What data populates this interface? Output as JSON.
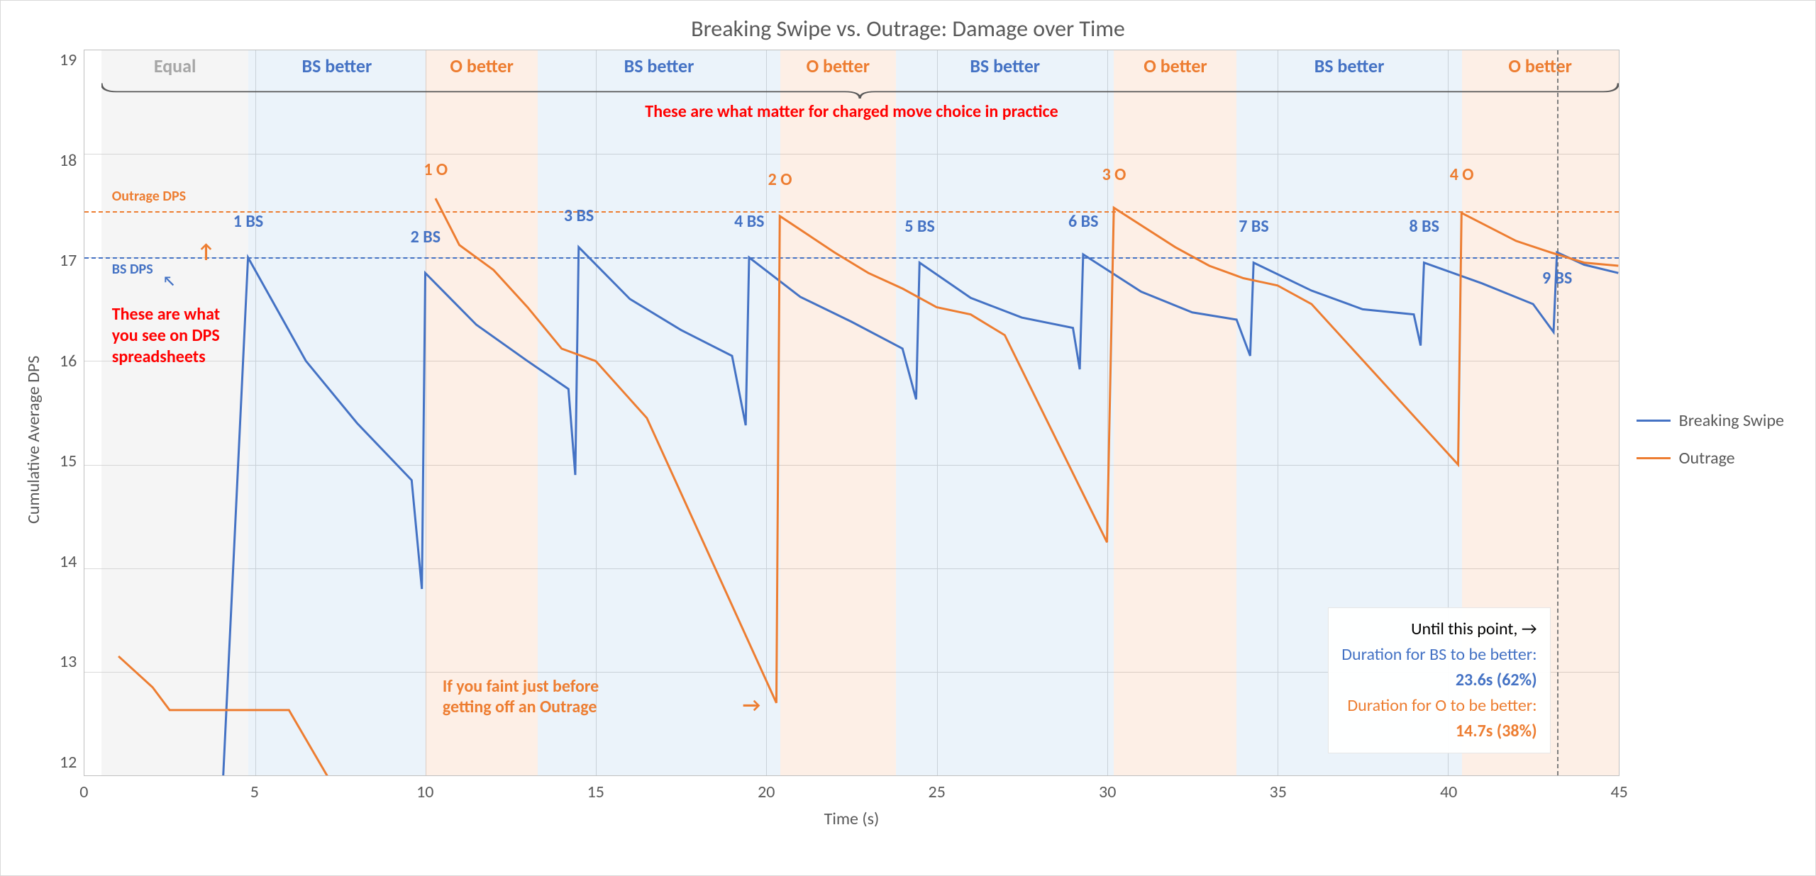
{
  "title": "Breaking Swipe vs. Outrage: Damage over Time",
  "ylabel": "Cumulative Average DPS",
  "xlabel": "Time (s)",
  "legend": {
    "series1": "Breaking Swipe",
    "series2": "Outrage"
  },
  "colors": {
    "blue": "#4472c4",
    "orange": "#ed7d31",
    "red": "#ff0000",
    "gray": "#a6a6a6"
  },
  "refs": {
    "bs_dps_label": "BS DPS",
    "outrage_dps_label": "Outrage DPS"
  },
  "bands": {
    "equal": "Equal",
    "bs": "BS better",
    "o": "O better"
  },
  "peaks": {
    "bs1": "1 BS",
    "bs2": "2 BS",
    "bs3": "3 BS",
    "bs4": "4 BS",
    "bs5": "5 BS",
    "bs6": "6 BS",
    "bs7": "7 BS",
    "bs8": "8 BS",
    "bs9": "9 BS",
    "o1": "1 O",
    "o2": "2 O",
    "o3": "3 O",
    "o4": "4 O"
  },
  "annotations": {
    "top_red": "These are what matter for charged move choice in practice",
    "left_red": "These are what\nyou see on DPS\nspreadsheets",
    "faint": "If you faint just before\ngetting off an Outrage"
  },
  "callout": {
    "line1": "Until this point,  →",
    "line2": "Duration for BS to be better:",
    "line2_val": "23.6s (62%)",
    "line3": "Duration for O to be better:",
    "line3_val": "14.7s (38%)"
  },
  "chart_data": {
    "type": "line",
    "title": "Breaking Swipe vs. Outrage: Damage over Time",
    "xlabel": "Time (s)",
    "ylabel": "Cumulative Average DPS",
    "xlim": [
      0,
      45
    ],
    "ylim": [
      12,
      19
    ],
    "x_ticks": [
      0,
      5,
      10,
      15,
      20,
      25,
      30,
      35,
      40,
      45
    ],
    "y_ticks": [
      12,
      13,
      14,
      15,
      16,
      17,
      18,
      19
    ],
    "reference_lines": {
      "bs_dps": 17.0,
      "outrage_dps": 17.45
    },
    "bands": [
      {
        "label": "Equal",
        "start": 0.5,
        "end": 4.8,
        "type": "gray"
      },
      {
        "label": "BS better",
        "start": 4.8,
        "end": 10.0,
        "type": "blue"
      },
      {
        "label": "O better",
        "start": 10.0,
        "end": 13.3,
        "type": "orange"
      },
      {
        "label": "BS better",
        "start": 13.3,
        "end": 20.4,
        "type": "blue"
      },
      {
        "label": "O better",
        "start": 20.4,
        "end": 23.8,
        "type": "orange"
      },
      {
        "label": "BS better",
        "start": 23.8,
        "end": 30.2,
        "type": "blue"
      },
      {
        "label": "O better",
        "start": 30.2,
        "end": 33.8,
        "type": "orange"
      },
      {
        "label": "BS better",
        "start": 33.8,
        "end": 40.4,
        "type": "blue"
      },
      {
        "label": "O better",
        "start": 40.4,
        "end": 45.0,
        "type": "orange"
      }
    ],
    "series": [
      {
        "name": "Breaking Swipe",
        "color": "#4472c4",
        "segments": [
          [
            [
              4.0,
              11.5
            ],
            [
              4.8,
              17.0
            ],
            [
              6.5,
              16.0
            ],
            [
              8.0,
              15.4
            ],
            [
              9.6,
              14.85
            ],
            [
              9.9,
              13.8
            ],
            [
              10.0,
              16.85
            ],
            [
              11.5,
              16.35
            ],
            [
              13.0,
              16.0
            ],
            [
              14.2,
              15.73
            ],
            [
              14.4,
              14.9
            ],
            [
              14.5,
              17.1
            ],
            [
              16.0,
              16.6
            ],
            [
              17.5,
              16.3
            ],
            [
              19.0,
              16.05
            ],
            [
              19.4,
              15.38
            ],
            [
              19.5,
              17.0
            ],
            [
              21.0,
              16.62
            ],
            [
              22.5,
              16.38
            ],
            [
              24.0,
              16.12
            ],
            [
              24.4,
              15.63
            ],
            [
              24.5,
              16.95
            ],
            [
              26.0,
              16.61
            ],
            [
              27.5,
              16.42
            ],
            [
              29.0,
              16.32
            ],
            [
              29.2,
              15.92
            ],
            [
              29.3,
              17.03
            ],
            [
              31.0,
              16.67
            ],
            [
              32.5,
              16.47
            ],
            [
              33.8,
              16.4
            ],
            [
              34.2,
              16.05
            ],
            [
              34.3,
              16.95
            ],
            [
              36.0,
              16.68
            ],
            [
              37.5,
              16.5
            ],
            [
              39.0,
              16.45
            ],
            [
              39.2,
              16.15
            ],
            [
              39.3,
              16.95
            ],
            [
              41.0,
              16.75
            ],
            [
              42.5,
              16.55
            ],
            [
              43.1,
              16.28
            ],
            [
              43.2,
              17.05
            ],
            [
              44.0,
              16.93
            ],
            [
              45.0,
              16.85
            ]
          ]
        ],
        "peak_labels": [
          {
            "label": "1 BS",
            "x": 4.8,
            "y": 17.25
          },
          {
            "label": "2 BS",
            "x": 10.0,
            "y": 17.1
          },
          {
            "label": "3 BS",
            "x": 14.5,
            "y": 17.3
          },
          {
            "label": "4 BS",
            "x": 19.5,
            "y": 17.25
          },
          {
            "label": "5 BS",
            "x": 24.5,
            "y": 17.2
          },
          {
            "label": "6 BS",
            "x": 29.3,
            "y": 17.25
          },
          {
            "label": "7 BS",
            "x": 34.3,
            "y": 17.2
          },
          {
            "label": "8 BS",
            "x": 39.3,
            "y": 17.2
          },
          {
            "label": "9 BS",
            "x": 43.2,
            "y": 16.7
          }
        ]
      },
      {
        "name": "Outrage",
        "color": "#ed7d31",
        "segments": [
          [
            [
              1.0,
              13.15
            ],
            [
              2.0,
              12.85
            ],
            [
              2.5,
              12.63
            ],
            [
              4.5,
              12.63
            ],
            [
              6.0,
              12.63
            ],
            [
              8.0,
              11.5
            ]
          ],
          [
            [
              10.3,
              17.57
            ],
            [
              11.0,
              17.12
            ],
            [
              12.0,
              16.88
            ],
            [
              13.0,
              16.52
            ],
            [
              14.0,
              16.12
            ],
            [
              15.0,
              16.0
            ],
            [
              16.5,
              15.45
            ],
            [
              20.3,
              12.7
            ],
            [
              20.4,
              17.4
            ],
            [
              22.0,
              17.05
            ],
            [
              23.0,
              16.85
            ],
            [
              24.0,
              16.7
            ],
            [
              25.0,
              16.52
            ],
            [
              26.0,
              16.45
            ],
            [
              27.0,
              16.25
            ],
            [
              30.0,
              14.25
            ],
            [
              30.2,
              17.48
            ],
            [
              32.0,
              17.1
            ],
            [
              33.0,
              16.92
            ],
            [
              34.0,
              16.8
            ],
            [
              35.0,
              16.73
            ],
            [
              36.0,
              16.55
            ],
            [
              40.3,
              15.0
            ],
            [
              40.4,
              17.43
            ],
            [
              42.0,
              17.16
            ],
            [
              43.0,
              17.05
            ],
            [
              44.0,
              16.95
            ],
            [
              45.0,
              16.92
            ]
          ]
        ],
        "peak_labels": [
          {
            "label": "1 O",
            "x": 10.3,
            "y": 17.75
          },
          {
            "label": "2 O",
            "x": 20.4,
            "y": 17.65
          },
          {
            "label": "3 O",
            "x": 30.2,
            "y": 17.7
          },
          {
            "label": "4 O",
            "x": 40.4,
            "y": 17.7
          }
        ]
      }
    ],
    "vertical_marker": 43.2,
    "callout": {
      "bs_better_duration_s": 23.6,
      "bs_better_pct": 62,
      "o_better_duration_s": 14.7,
      "o_better_pct": 38
    }
  }
}
